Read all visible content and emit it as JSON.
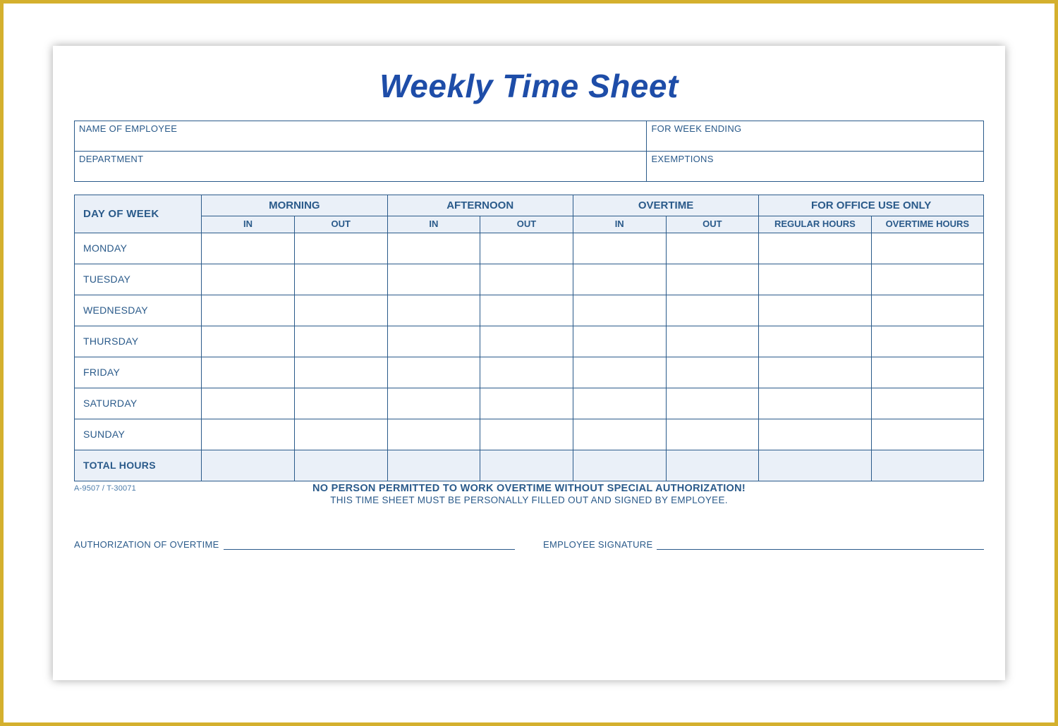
{
  "title": "Weekly Time Sheet",
  "info": {
    "name_label": "NAME OF EMPLOYEE",
    "week_ending_label": "FOR WEEK ENDING",
    "department_label": "DEPARTMENT",
    "exemptions_label": "EXEMPTIONS"
  },
  "columns": {
    "day_of_week": "DAY OF WEEK",
    "morning": "MORNING",
    "afternoon": "AFTERNOON",
    "overtime": "OVERTIME",
    "office_use": "FOR OFFICE USE ONLY",
    "in": "IN",
    "out": "OUT",
    "regular_hours": "REGULAR HOURS",
    "overtime_hours": "OVERTIME HOURS"
  },
  "days": [
    "MONDAY",
    "TUESDAY",
    "WEDNESDAY",
    "THURSDAY",
    "FRIDAY",
    "SATURDAY",
    "SUNDAY"
  ],
  "total_hours_label": "TOTAL HOURS",
  "form_code": "A-9507 / T-30071",
  "notice": "NO PERSON PERMITTED TO WORK OVERTIME WITHOUT SPECIAL AUTHORIZATION!",
  "subnotice": "THIS TIME SHEET MUST BE PERSONALLY FILLED OUT AND SIGNED BY EMPLOYEE.",
  "signatures": {
    "authorization": "AUTHORIZATION OF OVERTIME",
    "employee": "EMPLOYEE SIGNATURE"
  }
}
